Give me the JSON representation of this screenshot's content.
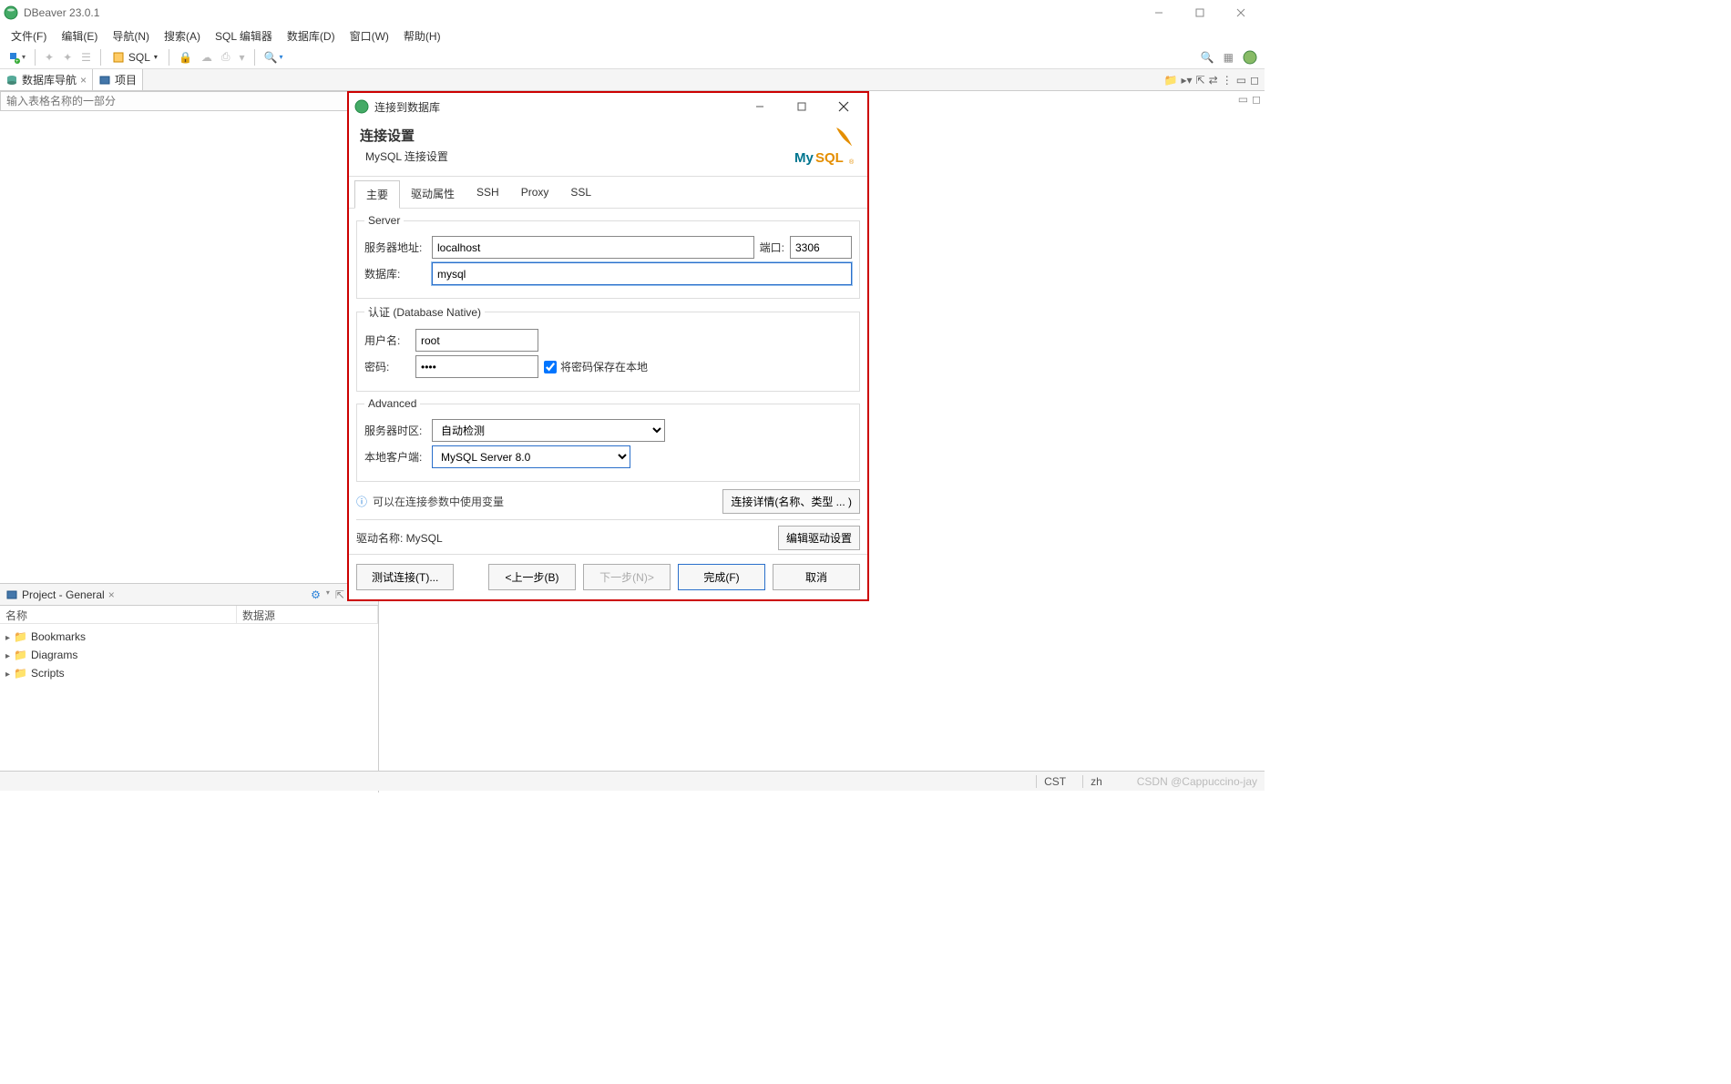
{
  "app": {
    "title": "DBeaver 23.0.1"
  },
  "menu": {
    "items": [
      "文件(F)",
      "编辑(E)",
      "导航(N)",
      "搜索(A)",
      "SQL 编辑器",
      "数据库(D)",
      "窗口(W)",
      "帮助(H)"
    ]
  },
  "toolbar": {
    "sql_label": "SQL"
  },
  "views": {
    "nav_tab": "数据库导航",
    "project_tab": "项目",
    "filter_placeholder": "输入表格名称的一部分"
  },
  "project_panel": {
    "title": "Project - General",
    "col_name": "名称",
    "col_datasource": "数据源",
    "nodes": [
      "Bookmarks",
      "Diagrams",
      "Scripts"
    ]
  },
  "statusbar": {
    "cst": "CST",
    "lang": "zh",
    "watermark": "CSDN @Cappuccino-jay"
  },
  "dialog": {
    "title": "连接到数据库",
    "header_title": "连接设置",
    "header_sub": "MySQL 连接设置",
    "tabs": [
      "主要",
      "驱动属性",
      "SSH",
      "Proxy",
      "SSL"
    ],
    "server_legend": "Server",
    "label_host": "服务器地址:",
    "value_host": "localhost",
    "label_port": "端口:",
    "value_port": "3306",
    "label_database": "数据库:",
    "value_database": "mysql",
    "auth_legend": "认证 (Database Native)",
    "label_username": "用户名:",
    "value_username": "root",
    "label_password": "密码:",
    "value_password": "••••",
    "save_password_label": "将密码保存在本地",
    "advanced_legend": "Advanced",
    "label_timezone": "服务器时区:",
    "value_timezone": "自动检测",
    "label_local_client": "本地客户端:",
    "value_local_client": "MySQL Server 8.0",
    "hint_text": "可以在连接参数中使用变量",
    "btn_details": "连接详情(名称、类型 ... )",
    "driver_label": "驱动名称: MySQL",
    "btn_edit_driver": "编辑驱动设置",
    "btn_test": "测试连接(T)...",
    "btn_back": "<上一步(B)",
    "btn_next": "下一步(N)>",
    "btn_finish": "完成(F)",
    "btn_cancel": "取消"
  }
}
